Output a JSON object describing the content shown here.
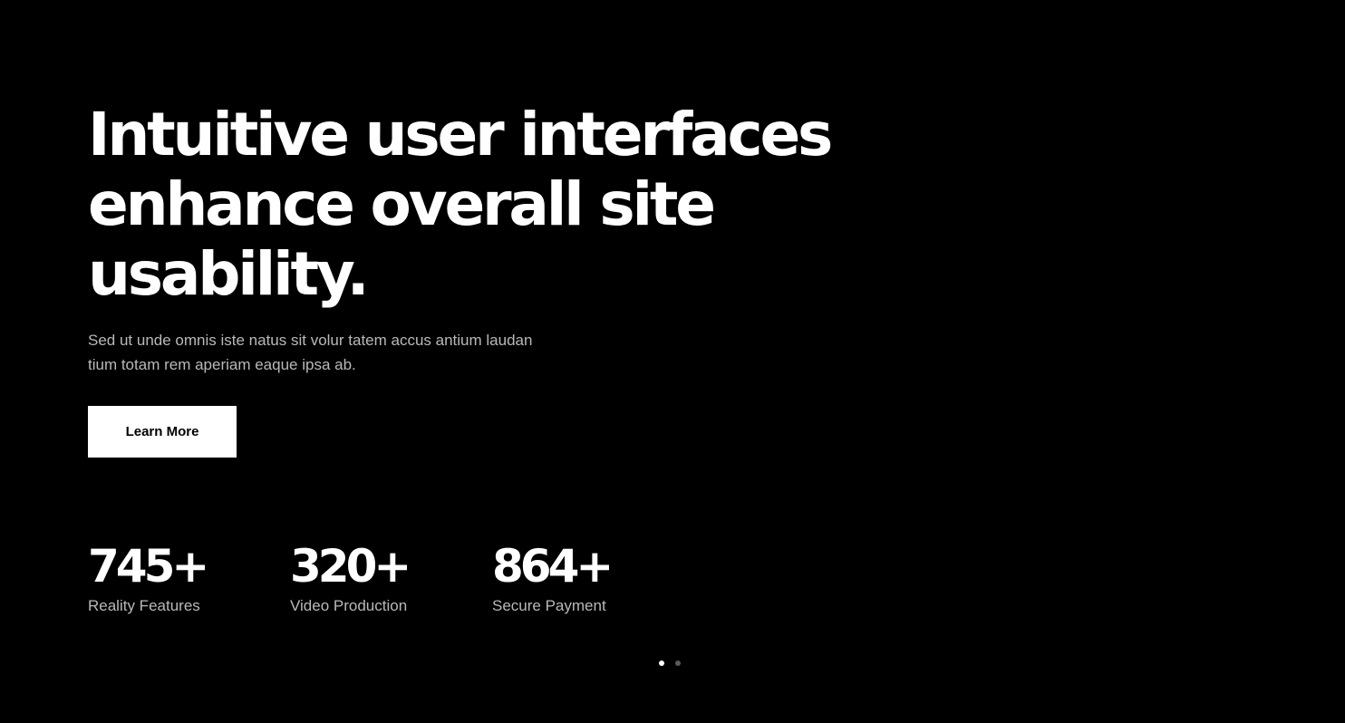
{
  "hero": {
    "title_lines": [
      "Intuitive user interfaces",
      "enhance overall site",
      "usability."
    ],
    "description_lines": [
      "Sed ut unde omnis iste natus sit volur tatem accus antium laudan",
      "tium totam rem aperiam eaque ipsa ab."
    ],
    "button_label": "Learn More"
  },
  "stats": [
    {
      "value": "745+",
      "label": "Reality Features"
    },
    {
      "value": "320+",
      "label": "Video Production"
    },
    {
      "value": "864+",
      "label": "Secure Payment"
    }
  ],
  "slider": {
    "total": 2,
    "active_index": 0
  },
  "colors": {
    "background": "#000000",
    "text_primary": "#ffffff",
    "text_muted": "#b9b9b9",
    "button_bg": "#ffffff",
    "button_text": "#000000",
    "dot_inactive": "#5a5a5a"
  }
}
